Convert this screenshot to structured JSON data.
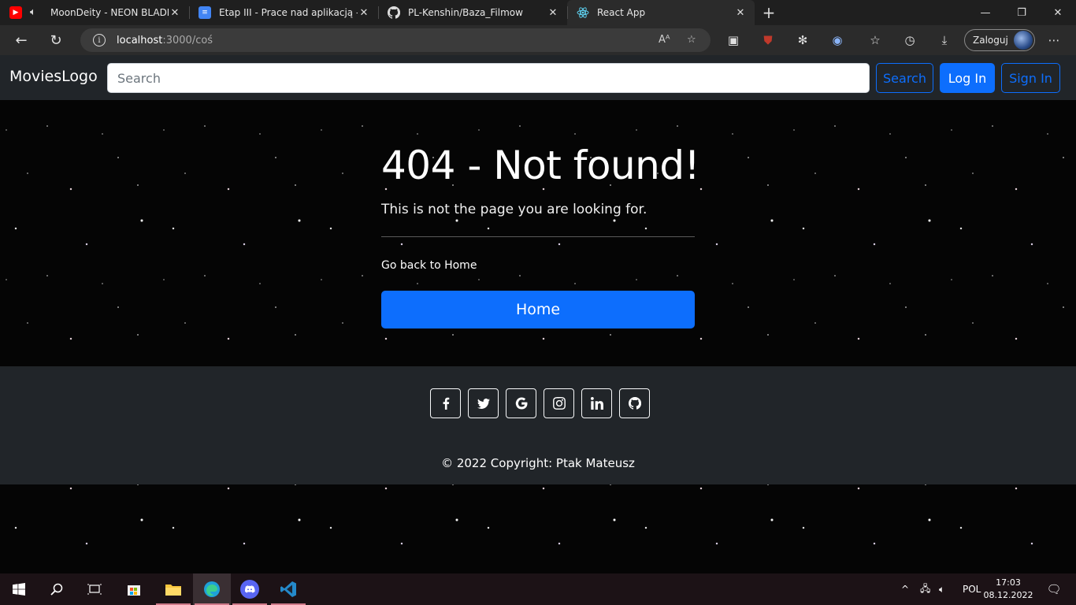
{
  "browser": {
    "tabs": [
      {
        "title": "MoonDeity - NEON BLADE",
        "favicon": "youtube-icon",
        "audio": true
      },
      {
        "title": "Etap III - Prace nad aplikacją - Do",
        "favicon": "google-docs-icon"
      },
      {
        "title": "PL-Kenshin/Baza_Filmow",
        "favicon": "github-icon"
      },
      {
        "title": "React App",
        "favicon": "react-icon",
        "active": true
      }
    ],
    "new_tab": "+",
    "url_host": "localhost",
    "url_path": ":3000/coś",
    "profile_label": "Zaloguj"
  },
  "navbar": {
    "brand": "MoviesLogo",
    "search_placeholder": "Search",
    "search_button": "Search",
    "login_button": "Log In",
    "signin_button": "Sign In"
  },
  "not_found": {
    "heading": "404 - Not found!",
    "lead": "This is not the page you are looking for.",
    "go_back": "Go back to Home",
    "home_button": "Home"
  },
  "footer": {
    "socials": [
      "facebook-icon",
      "twitter-icon",
      "google-icon",
      "instagram-icon",
      "linkedin-icon",
      "github-icon"
    ],
    "copyright": "© 2022 Copyright: Ptak Mateusz"
  },
  "taskbar": {
    "language": "POL",
    "time": "17:03",
    "date": "08.12.2022"
  },
  "colors": {
    "primary": "#0d6efd",
    "navbar_bg": "#212529",
    "browser_bg": "#2b2b2b"
  }
}
